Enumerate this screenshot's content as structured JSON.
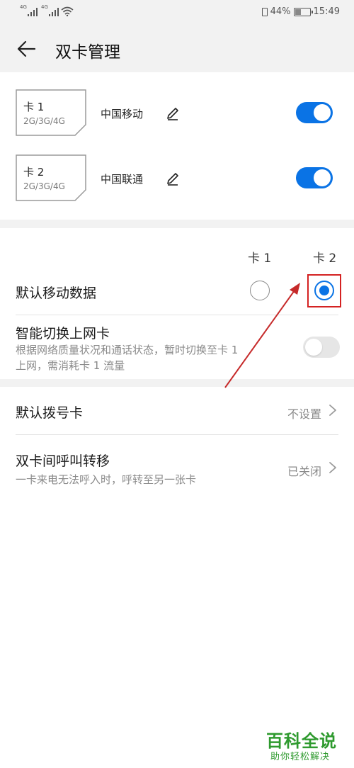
{
  "status_bar": {
    "sim1_network": "4G",
    "sim2_network": "4G",
    "battery": "44%",
    "battery_level": 0.44,
    "time": "15:49"
  },
  "header": {
    "title": "双卡管理"
  },
  "sims": [
    {
      "card": "卡 1",
      "bands": "2G/3G/4G",
      "carrier": "中国移动",
      "enabled": true
    },
    {
      "card": "卡 2",
      "bands": "2G/3G/4G",
      "carrier": "中国联通",
      "enabled": true
    }
  ],
  "data_section": {
    "col1": "卡 1",
    "col2": "卡 2",
    "default_data": {
      "label": "默认移动数据",
      "selected": "卡 2"
    },
    "smart_switch": {
      "label": "智能切换上网卡",
      "desc_line1": "根据网络质量状况和通话状态，暂时切换至卡 1",
      "desc_line2": "上网，需消耗卡 1 流量",
      "enabled": false
    }
  },
  "call_section": {
    "default_dial": {
      "label": "默认拨号卡",
      "value": "不设置"
    },
    "forwarding": {
      "label": "双卡间呼叫转移",
      "desc": "一卡来电无法呼入时，呼转至另一张卡",
      "value": "已关闭"
    }
  },
  "watermark": {
    "main": "百科全说",
    "sub": "助你轻松解决"
  },
  "colors": {
    "accent": "#0a73e5",
    "annotation": "#d42222",
    "watermark": "#2e9a2e"
  }
}
